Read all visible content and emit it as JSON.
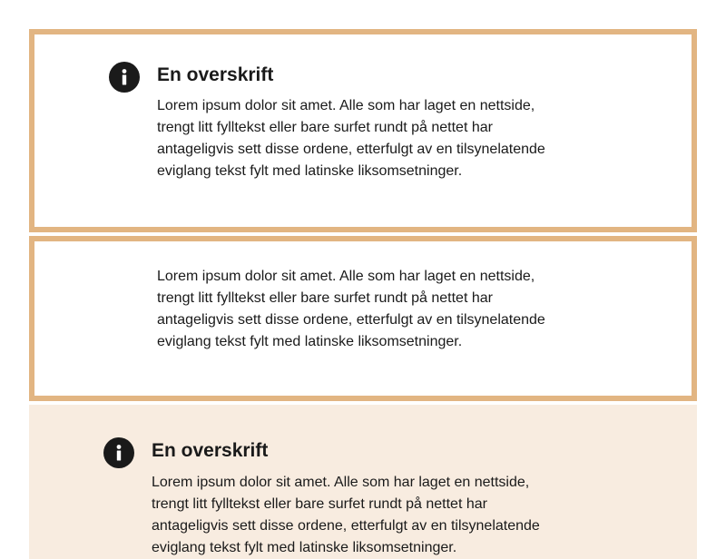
{
  "colors": {
    "border": "#e2b582",
    "fill": "#f8ece0",
    "text": "#1a1a1a",
    "icon": "#1a1a1a"
  },
  "panels": [
    {
      "style": "outlined",
      "icon": "info-icon",
      "heading": "En overskrift",
      "body": "Lorem ipsum dolor sit amet. Alle som har laget en nettside, trengt litt fylltekst eller bare surfet rundt på nettet har antageligvis sett disse ordene, etterfulgt av en tilsynelatende eviglang tekst fylt med latinske liksomsetninger."
    },
    {
      "style": "outlined",
      "body": "Lorem ipsum dolor sit amet. Alle som har laget en nettside, trengt litt fylltekst eller bare surfet rundt på nettet har antageligvis sett disse ordene, etterfulgt av en tilsynelatende eviglang tekst fylt med latinske liksomsetninger."
    },
    {
      "style": "filled",
      "icon": "info-icon",
      "heading": "En overskrift",
      "body": "Lorem ipsum dolor sit amet. Alle som har laget en nettside, trengt litt fylltekst eller bare surfet rundt på nettet har antageligvis sett disse ordene, etterfulgt av en tilsynelatende eviglang tekst fylt med latinske liksomsetninger."
    }
  ]
}
